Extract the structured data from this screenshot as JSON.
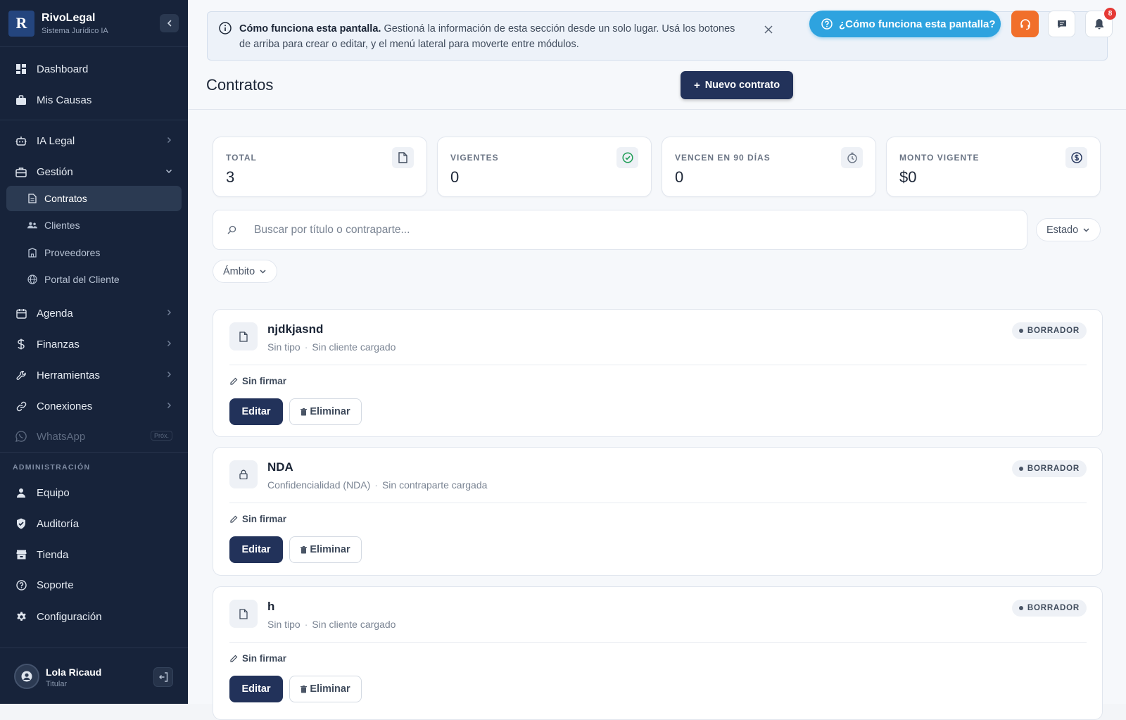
{
  "sidebar": {
    "logo_letter": "R",
    "brand_name": "RivoLegal",
    "brand_sub": "Sistema Jurídico IA",
    "items": {
      "dashboard": "Dashboard",
      "mis_causas": "Mis Causas",
      "ia_legal": "IA Legal",
      "gestion": "Gestión",
      "contratos": "Contratos",
      "clientes": "Clientes",
      "proveedores": "Proveedores",
      "portal": "Portal del Cliente",
      "agenda": "Agenda",
      "finanzas": "Finanzas",
      "herramientas": "Herramientas",
      "conexiones": "Conexiones",
      "whatsapp": "WhatsApp",
      "whatsapp_badge": "Próx.",
      "section_admin": "ADMINISTRACIÓN",
      "equipo": "Equipo",
      "auditoria": "Auditoría",
      "tienda": "Tienda",
      "soporte": "Soporte",
      "configuracion": "Configuración"
    },
    "user": {
      "name": "Lola Ricaud",
      "role": "Titular"
    }
  },
  "banner": {
    "title": "Cómo funciona esta pantalla.",
    "text": "Gestioná la información de esta sección desde un solo lugar. Usá los botones de arriba para crear o editar, y el menú lateral para moverte entre módulos."
  },
  "header": {
    "help_label": "¿Cómo funciona esta pantalla?",
    "notification_count": "8",
    "page_title": "Contratos",
    "new_button": "Nuevo contrato"
  },
  "stats": [
    {
      "label": "TOTAL",
      "value": "3",
      "icon": "file-icon"
    },
    {
      "label": "VIGENTES",
      "value": "0",
      "icon": "check-circle-icon"
    },
    {
      "label": "VENCEN EN 90 DÍAS",
      "value": "0",
      "icon": "clock-icon"
    },
    {
      "label": "MONTO VIGENTE",
      "value": "$0",
      "icon": "dollar-icon"
    }
  ],
  "filters": {
    "search_placeholder": "Buscar por título o contraparte...",
    "estado_label": "Estado",
    "ambito_label": "Ámbito"
  },
  "contracts": [
    {
      "title": "njdkjasnd",
      "type": "Sin tipo",
      "party": "Sin cliente cargado",
      "status": "BORRADOR",
      "sign": "Sin firmar",
      "icon": "file-icon"
    },
    {
      "title": "NDA",
      "type": "Confidencialidad (NDA)",
      "party": "Sin contraparte cargada",
      "status": "BORRADOR",
      "sign": "Sin firmar",
      "icon": "lock-icon"
    },
    {
      "title": "h",
      "type": "Sin tipo",
      "party": "Sin cliente cargado",
      "status": "BORRADOR",
      "sign": "Sin firmar",
      "icon": "file-icon"
    }
  ],
  "actions": {
    "edit": "Editar",
    "delete": "Eliminar"
  },
  "colors": {
    "sidebar_bg": "#17233a",
    "primary": "#22325a",
    "help_button": "#2ea3df",
    "support_button": "#f16f2a",
    "notification_badge": "#e53935",
    "success": "#1f9d55"
  }
}
